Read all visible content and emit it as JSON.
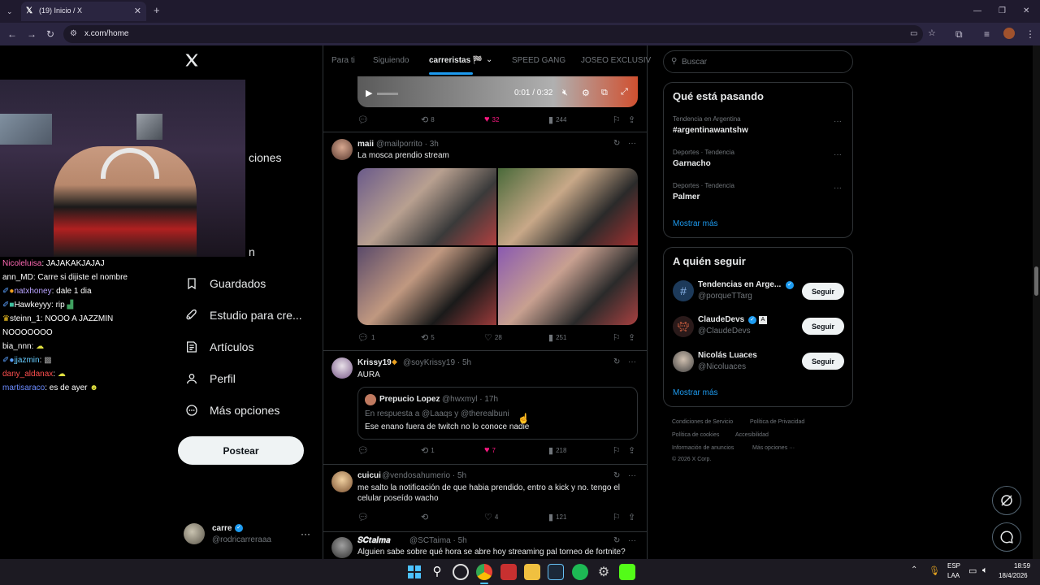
{
  "browser": {
    "tab_title": "(19) Inicio / X",
    "url": "x.com/home",
    "new_tab": "+",
    "window_controls": [
      "—",
      "❐",
      "✕"
    ]
  },
  "sidebar": {
    "partial_label": "ciones",
    "partial_label2": "n",
    "items": [
      {
        "label": "Guardados",
        "icon": "bookmark-icon"
      },
      {
        "label": "Estudio para cre...",
        "icon": "rocket-icon"
      },
      {
        "label": "Artículos",
        "icon": "article-icon"
      },
      {
        "label": "Perfil",
        "icon": "person-icon"
      },
      {
        "label": "Más opciones",
        "icon": "more-circle-icon"
      }
    ],
    "post_button": "Postear",
    "account": {
      "name": "carre",
      "handle": "@rodricarreraaa"
    }
  },
  "chat": [
    {
      "user": "Nicoleluisa",
      "color": "#ff69b4",
      "text": ": JAJAKAKJAJAJ"
    },
    {
      "user": "ann_MD",
      "color": "#ffffff",
      "text": ": Carre si dijiste el nombre"
    },
    {
      "user": "natxhoney",
      "color": "#b9a3ff",
      "text": ": dale 1 dia"
    },
    {
      "user": "Hawkeyyy",
      "color": "#ffffff",
      "text": ": rip"
    },
    {
      "user": "steinn_1",
      "color": "#ffffff",
      "text": ": NOOO A JAZZMIN"
    },
    {
      "user": "",
      "color": "#ffffff",
      "text": "NOOOOOOO"
    },
    {
      "user": "bia_nnn",
      "color": "#ffffff",
      "text": ":"
    },
    {
      "user": "jjazmin",
      "color": "#66ccff",
      "text": ":"
    },
    {
      "user": "dany_aldanax",
      "color": "#ff4f4f",
      "text": ":"
    },
    {
      "user": "martisaraco",
      "color": "#6b8bff",
      "text": ": es de ayer"
    }
  ],
  "feed_tabs": [
    "Para ti",
    "Siguiendo",
    "carreristas 🏁",
    "SPEED GANG",
    "JOSEO EXCLUSIV"
  ],
  "video": {
    "time": "0:01 / 0:32"
  },
  "tweet0": {
    "replies": "",
    "retweets": "8",
    "likes": "32",
    "views": "244"
  },
  "tweets": [
    {
      "name": "maii",
      "handle": "@mailporrito · 3h",
      "text": "La mosca prendio stream",
      "replies": "1",
      "retweets": "5",
      "likes": "28",
      "views": "251"
    },
    {
      "name": "Krissy19",
      "handle": "@soyKrissy19 · 5h",
      "text": "AURA",
      "replies": "",
      "retweets": "1",
      "likes": "7",
      "views": "218",
      "quote": {
        "name": "Prepucio Lopez",
        "handle": "@hwxmyl · 17h",
        "reply_to": "En respuesta a @Laaqs y @therealbuni",
        "text": "Ese enano fuera de twitch no lo conoce nadie"
      }
    },
    {
      "name": "cuicui",
      "handle": "@vendosahumerio · 5h",
      "text": "me salto la notificación de que habia prendido, entro a kick y no. tengo el celular poseído wacho",
      "replies": "",
      "retweets": "",
      "likes": "4",
      "views": "121"
    },
    {
      "name": "𝑺𝑪𝒕𝒂𝒊𝒎𝒂",
      "handle": "@SCTaima · 5h",
      "text": "Alguien sabe sobre qué hora se abre hoy streaming pal torneo de fortnite?"
    }
  ],
  "search": {
    "placeholder": "Buscar"
  },
  "trends": {
    "title": "Qué está pasando",
    "items": [
      {
        "category": "Tendencia en Argentina",
        "name": "#argentinawantshw"
      },
      {
        "category": "Deportes · Tendencia",
        "name": "Garnacho"
      },
      {
        "category": "Deportes · Tendencia",
        "name": "Palmer"
      }
    ],
    "show_more": "Mostrar más"
  },
  "who_to_follow": {
    "title": "A quién seguir",
    "items": [
      {
        "name": "Tendencias en Arge...",
        "handle": "@porqueTTarg",
        "button": "Seguir"
      },
      {
        "name": "ClaudeDevs",
        "handle": "@ClaudeDevs",
        "button": "Seguir"
      },
      {
        "name": "Nicolás Luaces",
        "handle": "@Nicoluaces",
        "button": "Seguir"
      }
    ],
    "show_more": "Mostrar más"
  },
  "footer": {
    "links": [
      "Condiciones de Servicio",
      "Política de Privacidad",
      "Política de cookies",
      "Accesibilidad",
      "Información de anuncios",
      "Más opciones ···"
    ],
    "copyright": "© 2026 X Corp."
  },
  "taskbar": {
    "lang": "ESP",
    "lang2": "LAA",
    "time": "18:59",
    "date": "18/4/2026"
  },
  "colors": {
    "accent": "#1d9bf0",
    "like": "#f91880",
    "verified": "#1d9bf0"
  }
}
